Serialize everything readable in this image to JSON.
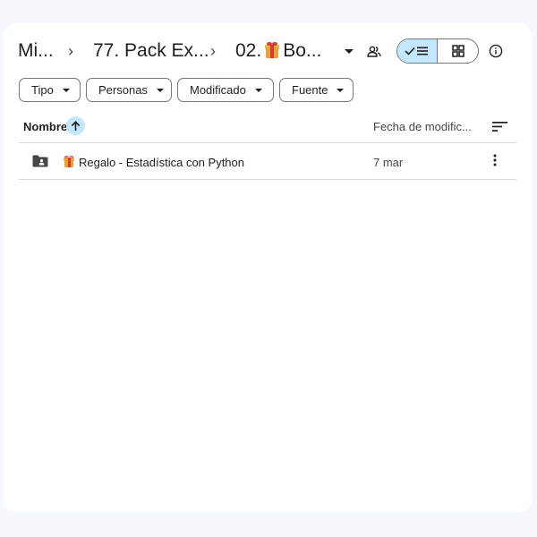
{
  "breadcrumb": {
    "items": [
      "Mi...",
      "77. Pack Ex...",
      "02.",
      "Bo..."
    ],
    "separator": "›"
  },
  "toolbar": {
    "share_icon": "people-icon",
    "view_list_icon": "list-check-icon",
    "view_grid_icon": "grid-icon",
    "info_icon": "info-icon"
  },
  "filters": [
    {
      "label": "Tipo"
    },
    {
      "label": "Personas"
    },
    {
      "label": "Modificado"
    },
    {
      "label": "Fuente"
    }
  ],
  "table": {
    "columns": {
      "name": "Nombre",
      "date": "Fecha de modific..."
    },
    "rows": [
      {
        "name": "Regalo - Estadística con Python",
        "date": "7 mar"
      }
    ]
  },
  "colors": {
    "accent": "#c2e7ff",
    "panel": "#ffffff",
    "background": "#f5f8fc"
  }
}
